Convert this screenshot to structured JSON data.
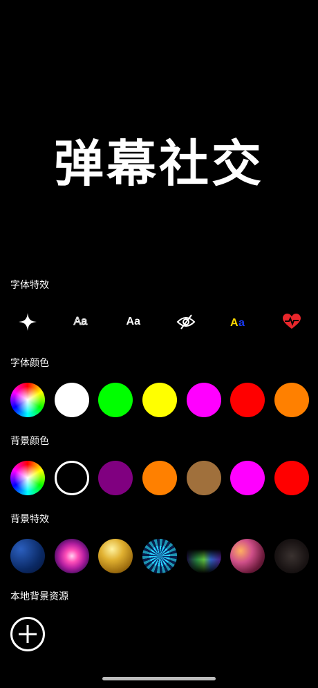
{
  "preview": {
    "text": "弹幕社交",
    "text_color": "#ffffff"
  },
  "sections": {
    "font_effects": {
      "label": "字体特效",
      "aa_label": "Aa",
      "icons": [
        "sparkle-icon",
        "outline-text-icon",
        "bold-text-icon",
        "eye-slash-icon",
        "rainbow-text-icon",
        "heartbeat-icon"
      ]
    },
    "font_color": {
      "label": "字体颜色",
      "colors": [
        "rainbow",
        "#ffffff",
        "#00ff00",
        "#ffff00",
        "#ff00ff",
        "#ff0000",
        "#ff8000"
      ]
    },
    "bg_color": {
      "label": "背景颜色",
      "colors": [
        "rainbow",
        "#000000",
        "#800080",
        "#ff8000",
        "#a0703c",
        "#ff00ff",
        "#ff0000"
      ]
    },
    "bg_effects": {
      "label": "背景特效",
      "effects": [
        "starfield",
        "neon-star",
        "gold-bokeh",
        "kaleidoscope",
        "aurora-lines",
        "pink-bokeh",
        "dark-sparkle"
      ]
    },
    "local_bg": {
      "label": "本地背景资源"
    }
  }
}
